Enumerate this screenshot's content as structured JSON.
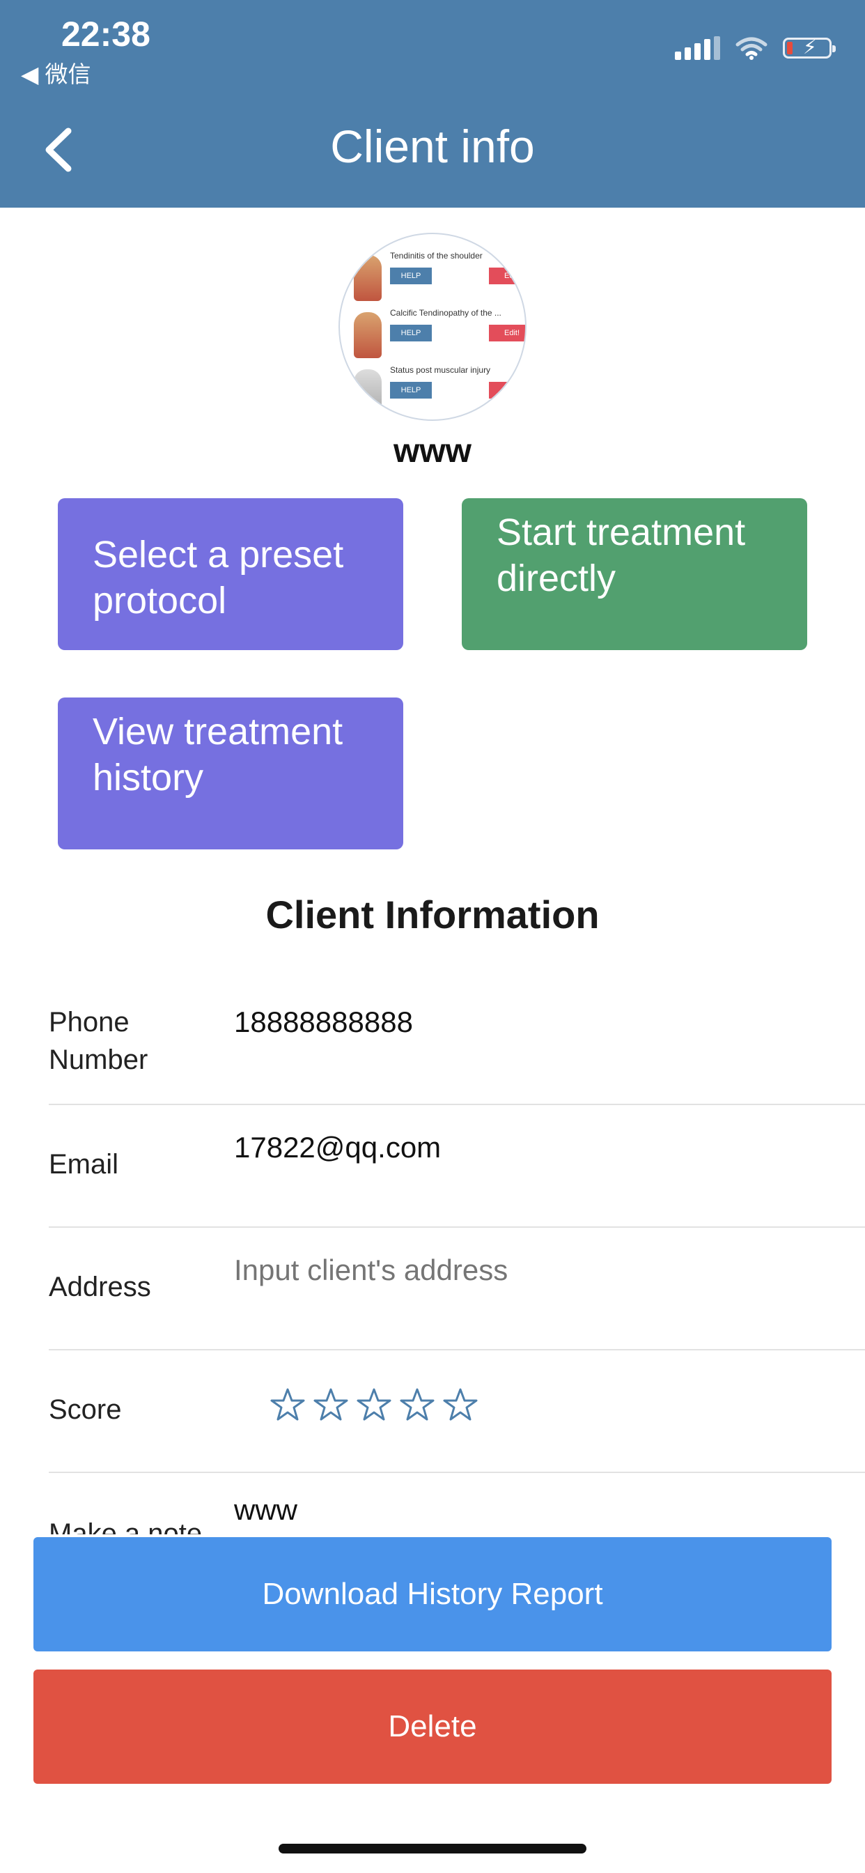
{
  "status_bar": {
    "time": "22:38",
    "back_app": "◀ 微信"
  },
  "nav": {
    "title": "Client info",
    "back_icon": "chevron-left-icon"
  },
  "avatar_thumb": {
    "rows": [
      {
        "text": "Tendinitis of the shoulder",
        "help": "HELP",
        "edit": "Edit!"
      },
      {
        "text": "Calcific Tendinopathy of the ...",
        "help": "HELP",
        "edit": "Edit!"
      },
      {
        "text": "Status post muscular injury",
        "help": "HELP",
        "edit": "Edit!"
      }
    ]
  },
  "client_name": "www",
  "actions": {
    "preset": "Select a preset protocol",
    "start": "Start treatment directly",
    "history": "View treatment history"
  },
  "section_title": "Client Information",
  "info": {
    "phone_label": "Phone Number",
    "phone_value": "18888888888",
    "email_label": "Email",
    "email_value": "17822@qq.com",
    "address_label": "Address",
    "address_placeholder": "Input client's address",
    "score_label": "Score",
    "score_value": 0,
    "score_max": 5,
    "note_label": "Make a note",
    "note_value": "www"
  },
  "buttons": {
    "download": "Download History Report",
    "delete": "Delete"
  },
  "colors": {
    "header": "#4d7fab",
    "preset": "#7670e0",
    "start": "#52a06f",
    "history": "#7670e0",
    "download": "#4a93ea",
    "delete": "#e05242",
    "star": "#4d7fab"
  }
}
